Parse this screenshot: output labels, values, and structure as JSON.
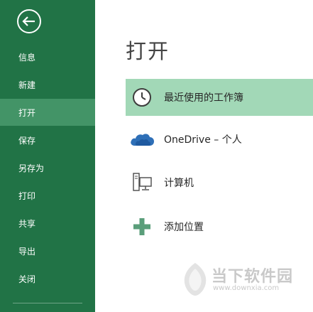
{
  "sidebar": {
    "back_icon": "back-arrow-icon",
    "items": [
      {
        "label": "信息"
      },
      {
        "label": "新建"
      },
      {
        "label": "打开"
      },
      {
        "label": "保存"
      },
      {
        "label": "另存为"
      },
      {
        "label": "打印"
      },
      {
        "label": "共享"
      },
      {
        "label": "导出"
      },
      {
        "label": "关闭"
      }
    ],
    "active_index": 2
  },
  "main": {
    "title": "打开",
    "locations": [
      {
        "label": "最近使用的工作簿",
        "icon": "clock-icon"
      },
      {
        "label": "OneDrive – 个人",
        "icon": "cloud-icon"
      },
      {
        "label": "计算机",
        "icon": "computer-icon"
      },
      {
        "label": "添加位置",
        "icon": "plus-icon"
      }
    ]
  },
  "watermark": {
    "name": "当下软件园",
    "url": "www.downxia.com"
  },
  "colors": {
    "sidebar_bg": "#217346",
    "sidebar_active": "#439467",
    "location_active": "#a2d8b7",
    "icon_blue": "#2e6fb7",
    "icon_green": "#5a9e7a"
  }
}
